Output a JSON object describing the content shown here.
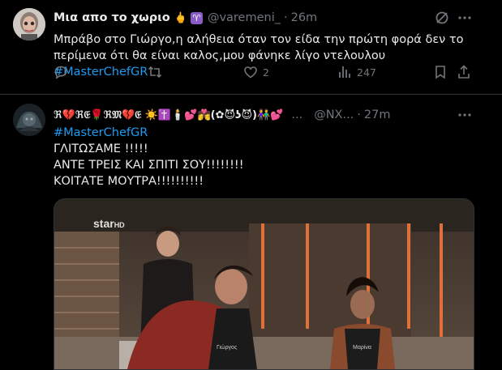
{
  "tweet1": {
    "display_name": "Μια απο το χωριο",
    "name_emojis": "🖕",
    "zodiac_badge": "♈",
    "handle": "@varemeni_",
    "separator": "·",
    "time": "26m",
    "text_line1": "Μπράβο στο Γιώργο,η αλήθεια όταν τον είδα την πρώτη φορά δεν το",
    "text_line2": "περίμενα ότι θα είναι καλος,μου φάνηκε λίγο ντελουλου",
    "hashtag": "#MasterChefGR",
    "likes": "2",
    "views": "247",
    "icons": [
      "grok-icon",
      "more-icon",
      "reply-icon",
      "retweet-icon",
      "like-icon",
      "views-icon",
      "bookmark-icon",
      "share-icon"
    ]
  },
  "tweet2": {
    "display_name": "ℜ💔ℜ𝔈🌹ℜ𝔐💔𝔈 ☀️✝️🕯️💕💏(✿😈ʖ😈)👫💕",
    "handle": "@NX...",
    "separator": "·",
    "time": "27m",
    "hashtag": "#MasterChefGR",
    "line1": "ΓΛΙΤΩΣΑΜΕ !!!!!",
    "line2": "ΑΝΤΕ ΤΡΕΙΣ ΚΑΙ ΣΠΙΤΙ ΣΟΥ!!!!!!!!",
    "line3": "ΚΟΙΤΑΤΕ ΜΟΥΤΡΑ!!!!!!!!!!",
    "media": {
      "logo_main": "star",
      "logo_suffix": "HD",
      "apron_left": "Γιώργος",
      "apron_right": "Μαρίνα"
    }
  }
}
